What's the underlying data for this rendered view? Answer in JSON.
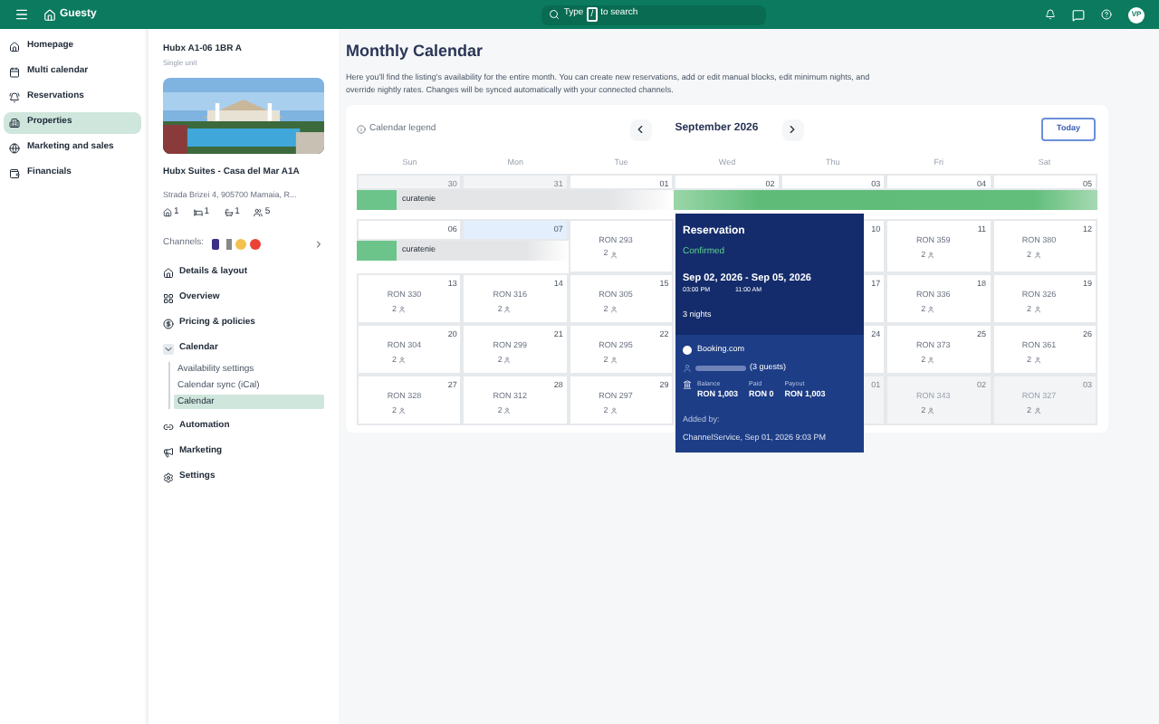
{
  "topbar": {
    "brand": "Guesty",
    "search": {
      "before": "Type",
      "key": "/",
      "after": "to search"
    },
    "avatar": "VP"
  },
  "nav": [
    {
      "label": "Homepage",
      "selected": false
    },
    {
      "label": "Multi calendar",
      "selected": false
    },
    {
      "label": "Reservations",
      "selected": false
    },
    {
      "label": "Properties",
      "selected": true
    },
    {
      "label": "Marketing and sales",
      "selected": false
    },
    {
      "label": "Financials",
      "selected": false
    }
  ],
  "property": {
    "code": "Hubx A1-06 1BR A",
    "type": "Single unit",
    "name": "Hubx Suites - Casa del Mar A1A",
    "address": "Strada Brizei 4, 905700 Mamaia, R...",
    "stats": [
      "1",
      "1",
      "1",
      "5"
    ],
    "channels_label": "Channels:",
    "menu": [
      {
        "label": "Details & layout"
      },
      {
        "label": "Overview"
      },
      {
        "label": "Pricing & policies"
      },
      {
        "label": "Calendar",
        "expanded": true,
        "children": [
          {
            "label": "Availability settings",
            "selected": false
          },
          {
            "label": "Calendar sync (iCal)",
            "selected": false
          },
          {
            "label": "Calendar",
            "selected": true
          }
        ]
      },
      {
        "label": "Automation"
      },
      {
        "label": "Marketing"
      },
      {
        "label": "Settings"
      }
    ]
  },
  "page": {
    "title": "Monthly Calendar",
    "description": "Here you'll find the listing's availability for the entire month. You can create new reservations, add or edit manual blocks, edit minimum nights, and override nightly rates. Changes will be synced automatically with your connected channels."
  },
  "calendar": {
    "legend": "Calendar legend",
    "month": "September 2026",
    "today": "Today",
    "weekdays": [
      "Sun",
      "Mon",
      "Tue",
      "Wed",
      "Thu",
      "Fri",
      "Sat"
    ],
    "weeks": [
      {
        "bars": [
          {
            "kind": "block",
            "label": "curatenie"
          },
          {
            "kind": "reservation"
          }
        ],
        "cells": [
          {
            "kind": "day",
            "date": "30",
            "muted": true
          },
          {
            "kind": "day",
            "date": "31",
            "muted": true
          },
          {
            "kind": "day",
            "date": "01",
            "muted": false
          },
          {
            "kind": "day",
            "date": "02",
            "muted": false
          },
          {
            "kind": "day",
            "date": "03",
            "muted": false
          },
          {
            "kind": "day",
            "date": "04",
            "muted": false
          },
          {
            "kind": "day",
            "date": "05",
            "muted": false
          }
        ]
      },
      {
        "bars": [
          {
            "kind": "block",
            "label": "curatenie"
          }
        ],
        "cells": [
          {
            "kind": "day",
            "date": "06",
            "muted": false
          },
          {
            "kind": "day",
            "date": "07",
            "muted": false,
            "selected": true
          },
          {
            "kind": "day",
            "muted": false,
            "price": "RON 293",
            "guests": "2"
          },
          {
            "kind": "covered"
          },
          {
            "kind": "partial",
            "date": "10",
            "muted": false
          },
          {
            "kind": "day",
            "date": "11",
            "muted": false,
            "price": "RON 359",
            "guests": "2"
          },
          {
            "kind": "day",
            "date": "12",
            "muted": false,
            "price": "RON 380",
            "guests": "2"
          }
        ]
      },
      {
        "cells": [
          {
            "kind": "day",
            "date": "13",
            "muted": false,
            "price": "RON 330",
            "guests": "2"
          },
          {
            "kind": "day",
            "date": "14",
            "muted": false,
            "price": "RON 316",
            "guests": "2"
          },
          {
            "kind": "day",
            "date": "15",
            "muted": false,
            "price": "RON 305",
            "guests": "2"
          },
          {
            "kind": "covered"
          },
          {
            "kind": "partial",
            "date": "17",
            "muted": false
          },
          {
            "kind": "day",
            "date": "18",
            "muted": false,
            "price": "RON 336",
            "guests": "2"
          },
          {
            "kind": "day",
            "date": "19",
            "muted": false,
            "price": "RON 326",
            "guests": "2"
          }
        ]
      },
      {
        "cells": [
          {
            "kind": "day",
            "date": "20",
            "muted": false,
            "price": "RON 304",
            "guests": "2"
          },
          {
            "kind": "day",
            "date": "21",
            "muted": false,
            "price": "RON 299",
            "guests": "2"
          },
          {
            "kind": "day",
            "date": "22",
            "muted": false,
            "price": "RON 295",
            "guests": "2"
          },
          {
            "kind": "covered"
          },
          {
            "kind": "partial",
            "date": "24",
            "muted": false
          },
          {
            "kind": "day",
            "date": "25",
            "muted": false,
            "price": "RON 373",
            "guests": "2"
          },
          {
            "kind": "day",
            "date": "26",
            "muted": false,
            "price": "RON 361",
            "guests": "2"
          }
        ]
      },
      {
        "cells": [
          {
            "kind": "day",
            "date": "27",
            "muted": false,
            "price": "RON 328",
            "guests": "2"
          },
          {
            "kind": "day",
            "date": "28",
            "muted": false,
            "price": "RON 312",
            "guests": "2"
          },
          {
            "kind": "day",
            "date": "29",
            "muted": false,
            "price": "RON 297",
            "guests": "2"
          },
          {
            "kind": "covered"
          },
          {
            "kind": "partial",
            "date": "01",
            "muted": true
          },
          {
            "kind": "day",
            "date": "02",
            "muted": true,
            "price": "RON 343",
            "guests": "2"
          },
          {
            "kind": "day",
            "date": "03",
            "muted": true,
            "price": "RON 327",
            "guests": "2"
          }
        ]
      }
    ]
  },
  "popup": {
    "title": "Reservation",
    "status": "Confirmed",
    "dates": "Sep 02, 2026 - Sep 05, 2026",
    "checkin": "03:00 PM",
    "checkout": "11:00 AM",
    "nights": "3 nights",
    "channel": "Booking.com",
    "guests": "(3 guests)",
    "amounts": [
      {
        "label": "Balance",
        "value": "RON 1,003"
      },
      {
        "label": "Paid",
        "value": "RON 0"
      },
      {
        "label": "Payout",
        "value": "RON 1,003"
      }
    ],
    "added_label": "Added by:",
    "added": "ChannelService, Sep 01, 2026 9:03 PM"
  }
}
